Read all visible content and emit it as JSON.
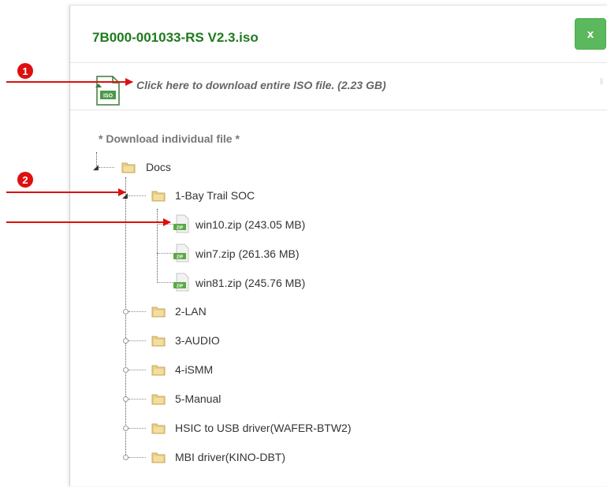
{
  "modal": {
    "title": "7B000-001033-RS V2.3.iso",
    "close_label": "x",
    "download_all_text": "Click here to download entire ISO file. (2.23 GB)",
    "individual_caption": "* Download individual file *"
  },
  "tree": {
    "root": "Docs",
    "folders": [
      {
        "label": "1-Bay Trail SOC",
        "expanded": true
      },
      {
        "label": "2-LAN"
      },
      {
        "label": "3-AUDIO"
      },
      {
        "label": "4-iSMM"
      },
      {
        "label": "5-Manual"
      },
      {
        "label": "HSIC to USB driver(WAFER-BTW2)"
      },
      {
        "label": "MBI driver(KINO-DBT)"
      }
    ],
    "files": [
      {
        "label": "win10.zip (243.05 MB)"
      },
      {
        "label": "win7.zip (261.36 MB)"
      },
      {
        "label": "win81.zip (245.76 MB)"
      }
    ]
  },
  "annotations": {
    "badge1": "1",
    "badge2": "2",
    "color": "#dd1010"
  },
  "icons": {
    "iso": "iso-file-icon",
    "folder": "folder-icon",
    "zip": "zip-file-icon"
  },
  "colors": {
    "title": "#1e7a1e",
    "close_button": "#5cb85c"
  }
}
